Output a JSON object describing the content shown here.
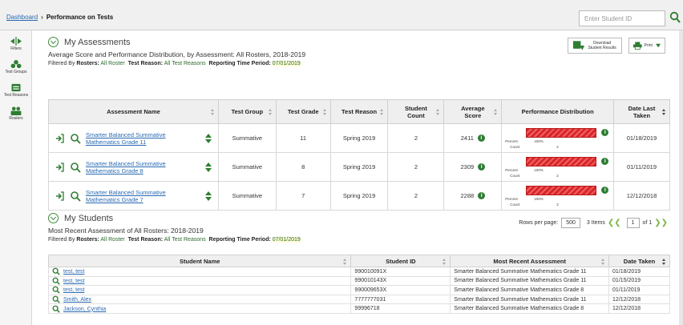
{
  "header": {
    "breadcrumb_home": "Dashboard",
    "breadcrumb_current": "Performance on Tests",
    "search_placeholder": "Enter Student ID"
  },
  "sidebar": {
    "items": [
      {
        "label": "Filters",
        "icon": "filters-icon"
      },
      {
        "label": "Test Groups",
        "icon": "test-groups-icon"
      },
      {
        "label": "Test Reasons",
        "icon": "test-reasons-icon"
      },
      {
        "label": "Rosters",
        "icon": "rosters-icon"
      }
    ]
  },
  "assessments": {
    "title": "My Assessments",
    "subtitle": "Average Score and Performance Distribution, by Assessment: All Rosters, 2018-2019",
    "filter_prefix": "Filtered By",
    "filter_rosters_label": "Rosters:",
    "filter_rosters_value": "All Roster",
    "filter_reason_label": "Test Reason:",
    "filter_reason_value": "All Test Reasons",
    "filter_period_label": "Reporting Time Period:",
    "filter_period_value": "07/01/2019",
    "download_label": "Download Student Results",
    "print_label": "Print",
    "columns": [
      "Assessment Name",
      "Test Group",
      "Test Grade",
      "Test Reason",
      "Student Count",
      "Average Score",
      "Performance Distribution",
      "Date Last Taken"
    ],
    "rows": [
      {
        "name": "Smarter Balanced Summative Mathematics Grade 11",
        "group": "Summative",
        "grade": "11",
        "reason": "Spring 2019",
        "count": "2",
        "avg": "2411",
        "percent": "100%",
        "pcount": "2",
        "date": "01/18/2019"
      },
      {
        "name": "Smarter Balanced Summative Mathematics Grade 8",
        "group": "Summative",
        "grade": "8",
        "reason": "Spring 2019",
        "count": "2",
        "avg": "2309",
        "percent": "100%",
        "pcount": "2",
        "date": "01/11/2019"
      },
      {
        "name": "Smarter Balanced Summative Mathematics Grade 7",
        "group": "Summative",
        "grade": "7",
        "reason": "Spring 2019",
        "count": "2",
        "avg": "2288",
        "percent": "100%",
        "pcount": "2",
        "date": "12/12/2018"
      }
    ],
    "perf_percent_label": "Percent",
    "perf_count_label": "Count",
    "pager": {
      "rows_label": "Rows per page:",
      "rows_value": "500",
      "items": "3 Items",
      "page": "1",
      "of": "of 1"
    }
  },
  "students": {
    "title": "My Students",
    "subtitle": "Most Recent Assessment of All Rosters: 2018-2019",
    "filter_prefix": "Filtered By",
    "filter_rosters_label": "Rosters:",
    "filter_rosters_value": "All Roster",
    "filter_reason_label": "Test Reason:",
    "filter_reason_value": "All Test Reasons",
    "filter_period_label": "Reporting Time Period:",
    "filter_period_value": "07/01/2019",
    "columns": [
      "Student Name",
      "Student ID",
      "Most Recent Assessment",
      "Date Taken"
    ],
    "rows": [
      {
        "name": "test, test",
        "id": "990010091X",
        "assessment": "Smarter Balanced Summative Mathematics Grade 11",
        "date": "01/18/2019"
      },
      {
        "name": "test, test",
        "id": "990010143X",
        "assessment": "Smarter Balanced Summative Mathematics Grade 11",
        "date": "01/15/2019"
      },
      {
        "name": "test, test",
        "id": "990009653X",
        "assessment": "Smarter Balanced Summative Mathematics Grade 8",
        "date": "01/11/2019"
      },
      {
        "name": "Smith, Alex",
        "id": "7777777031",
        "assessment": "Smarter Balanced Summative Mathematics Grade 11",
        "date": "12/12/2018"
      },
      {
        "name": "Jackson, Cynthia",
        "id": "99996718",
        "assessment": "Smarter Balanced Summative Mathematics Grade 8",
        "date": "12/12/2018"
      }
    ]
  }
}
